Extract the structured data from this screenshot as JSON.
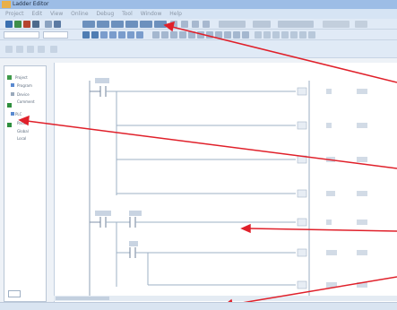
{
  "window": {
    "title": "Ladder Editor"
  },
  "menu": {
    "items": [
      "Project",
      "Edit",
      "View",
      "Online",
      "Debug",
      "Tool",
      "Window",
      "Help"
    ]
  },
  "left_panel": {
    "items": [
      "Project",
      "Program",
      "Device",
      "Comment",
      "PLC",
      "Param",
      "Global",
      "Local"
    ]
  },
  "editor": {
    "tab_labels": [
      "",
      ""
    ]
  },
  "status": {
    "text": ""
  },
  "colors": {
    "accent": "#e0202a",
    "panel": "#ffffff",
    "title": "#9dbde6"
  }
}
